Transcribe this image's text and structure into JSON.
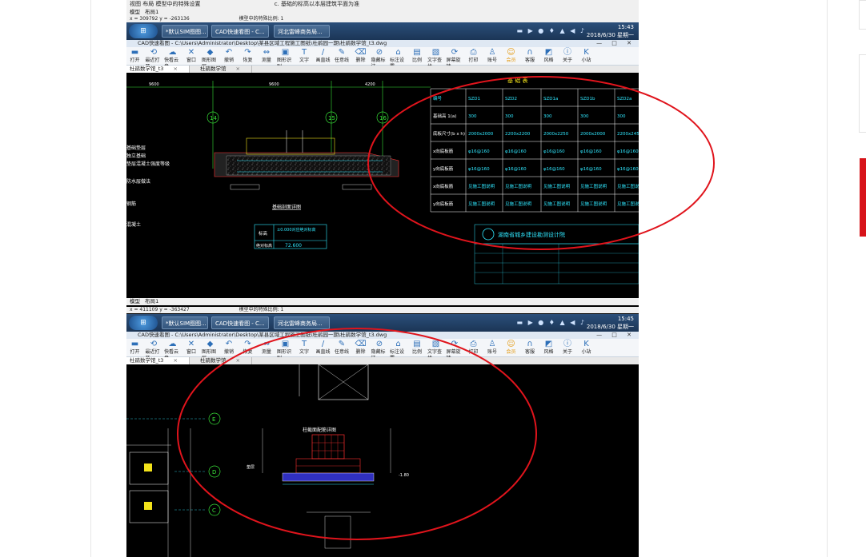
{
  "top_status": {
    "left_text": "视图 布局 模型中的特殊设置",
    "notice_text": "c. 基础的标高以本层建筑平面为准"
  },
  "layout_tabs": {
    "model": "模型",
    "layout": "布局1"
  },
  "coords": {
    "screen1": "x = 309792  y = -263136",
    "screen2": "x = 411109  y = -363427",
    "note": "模型中的特殊比例: 1"
  },
  "taskbar": {
    "start_label": "",
    "buttons": [
      "*默认SIM图图...",
      "CAD快速看图 - C...",
      "河北雷峰商务局..."
    ],
    "time1": "15:43",
    "date1": "2018/6/30 星期一",
    "time2": "15:45",
    "date2": "2018/6/30 星期一"
  },
  "app_title": "CAD快速看图 - C:\\Users\\Administrator\\Desktop\\某县区域工程施工图纸\\杜鹃园一期\\杜鹃数学馆_t3.dwg",
  "toolbar": {
    "items": [
      {
        "label": "打开",
        "icon": "folder-icon"
      },
      {
        "label": "最近打开",
        "icon": "history-icon"
      },
      {
        "label": "快看云盘",
        "icon": "cloud-icon"
      },
      {
        "label": "窗口",
        "icon": "window-icon"
      },
      {
        "label": "图形图层",
        "icon": "layers-icon"
      },
      {
        "label": "撤销",
        "icon": "undo-icon"
      },
      {
        "label": "恢复",
        "icon": "redo-icon"
      },
      {
        "label": "测量",
        "icon": "measure-icon"
      },
      {
        "label": "图形识别",
        "icon": "recognize-icon"
      },
      {
        "label": "文字",
        "icon": "text-icon"
      },
      {
        "label": "画直线",
        "icon": "line-icon"
      },
      {
        "label": "任意线",
        "icon": "pen-icon"
      },
      {
        "label": "删除",
        "icon": "eraser-icon"
      },
      {
        "label": "隐藏标注",
        "icon": "hide-icon"
      },
      {
        "label": "标注设置",
        "icon": "dimension-icon"
      },
      {
        "label": "比例",
        "icon": "scale-icon"
      },
      {
        "label": "文字查找",
        "icon": "find-icon"
      },
      {
        "label": "屏幕旋转",
        "icon": "rotate-icon"
      },
      {
        "label": "打印",
        "icon": "print-icon"
      },
      {
        "label": "账号",
        "icon": "user-icon"
      },
      {
        "label": "会员",
        "icon": "vip-icon"
      },
      {
        "label": "客服",
        "icon": "headset-icon"
      },
      {
        "label": "风格",
        "icon": "style-icon"
      },
      {
        "label": "关于",
        "icon": "info-icon"
      },
      {
        "label": "小站",
        "icon": "k-logo-icon"
      }
    ]
  },
  "doc_tabs": [
    {
      "label": "杜鹃数学馆_t3",
      "close": "×"
    },
    {
      "label": "杜鹃数学馆",
      "close": "×"
    }
  ],
  "drawing1": {
    "axis_labels": [
      "14",
      "15",
      "16"
    ],
    "dims": [
      "9600",
      "9600",
      "4200"
    ],
    "left_notes": [
      "基础垫层",
      "独立基础",
      "垫层混凝土强度等级",
      "防水层做法",
      "钢筋",
      "混凝土",
      "回填土"
    ],
    "section_title": "基础剖面详图",
    "elev_box": {
      "r1c1": "标高",
      "r1c2": "±0.000对应绝对标高",
      "r2c1": "绝对标高",
      "r2c2": "72.600"
    },
    "table": {
      "title": "基 础 表",
      "rows": [
        [
          "编号",
          "SZD1",
          "SZD2",
          "SZD1a",
          "SZD1b",
          "SZD2a"
        ],
        [
          "基础高 1(a)",
          "300",
          "300",
          "300",
          "300",
          "300"
        ],
        [
          "底板尺寸(b x h)",
          "2000x2000",
          "2200x2200",
          "2000x2250",
          "2000x2000",
          "2200x2450"
        ],
        [
          "x向底板筋",
          "φ16@160",
          "φ16@160",
          "φ16@160",
          "φ16@160",
          "φ16@160"
        ],
        [
          "y向底板筋",
          "φ16@160",
          "φ16@160",
          "φ16@160",
          "φ16@160",
          "φ16@160"
        ],
        [
          "x向底板筋",
          "见施工图说明",
          "见施工图说明",
          "见施工图说明",
          "见施工图说明",
          "见施工图说明"
        ],
        [
          "y向底板筋",
          "见施工图说明",
          "见施工图说明",
          "见施工图说明",
          "见施工图说明",
          "见施工图说明"
        ]
      ]
    },
    "stamp_title": "湖南省城乡建设勘测设计院"
  },
  "drawing2": {
    "axis_labels": [
      "E",
      "D",
      "C"
    ],
    "section_title": "柱截面配筋详图"
  },
  "colors": {
    "annotation": "#e0141c",
    "cad_bg": "#000000",
    "line_cyan": "#30e8ff",
    "line_green": "#38e038",
    "line_yellow": "#f2e21a",
    "line_red": "#ff3030",
    "accent_red": "#d7141a"
  }
}
